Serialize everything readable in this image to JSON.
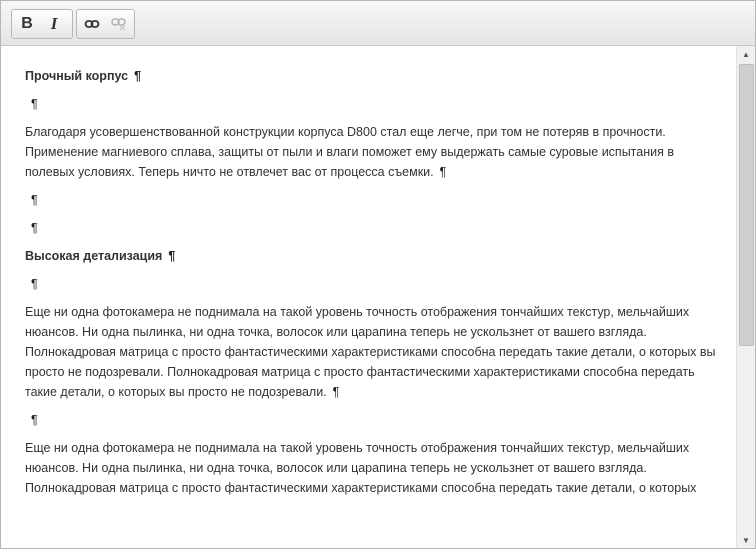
{
  "toolbar": {
    "bold_label": "B",
    "italic_label": "I",
    "link_icon": "link-icon",
    "unlink_icon": "unlink-icon"
  },
  "pilcrow": "¶",
  "content": {
    "heading1": "Прочный корпус",
    "para1": "Благодаря усовершенствованной конструкции корпуса D800 стал еще легче, при том не потеряв в прочности. Применение магниевого сплава, защиты от пыли и влаги поможет ему выдержать самые суровые испытания в полевых условиях. Теперь ничто не отвлечет вас от процесса съемки.",
    "heading2": "Высокая детализация",
    "para2": "Еще ни одна фотокамера не поднимала на такой уровень точность отображения тончайших текстур, мельчайших нюансов. Ни одна пылинка, ни одна точка, волосок или царапина теперь не ускользнет от вашего взгляда. Полнокадровая матрица с просто фантастическими характеристиками способна передать такие детали, о которых вы просто не подозревали. Полнокадровая матрица с просто фантастическими характеристиками способна передать такие детали, о которых вы просто не подозревали.",
    "para3": "Еще ни одна фотокамера не поднимала на такой уровень точность отображения тончайших текстур, мельчайших нюансов. Ни одна пылинка, ни одна точка, волосок или царапина теперь не ускользнет от вашего взгляда. Полнокадровая матрица с просто фантастическими характеристиками способна передать такие детали, о которых"
  }
}
